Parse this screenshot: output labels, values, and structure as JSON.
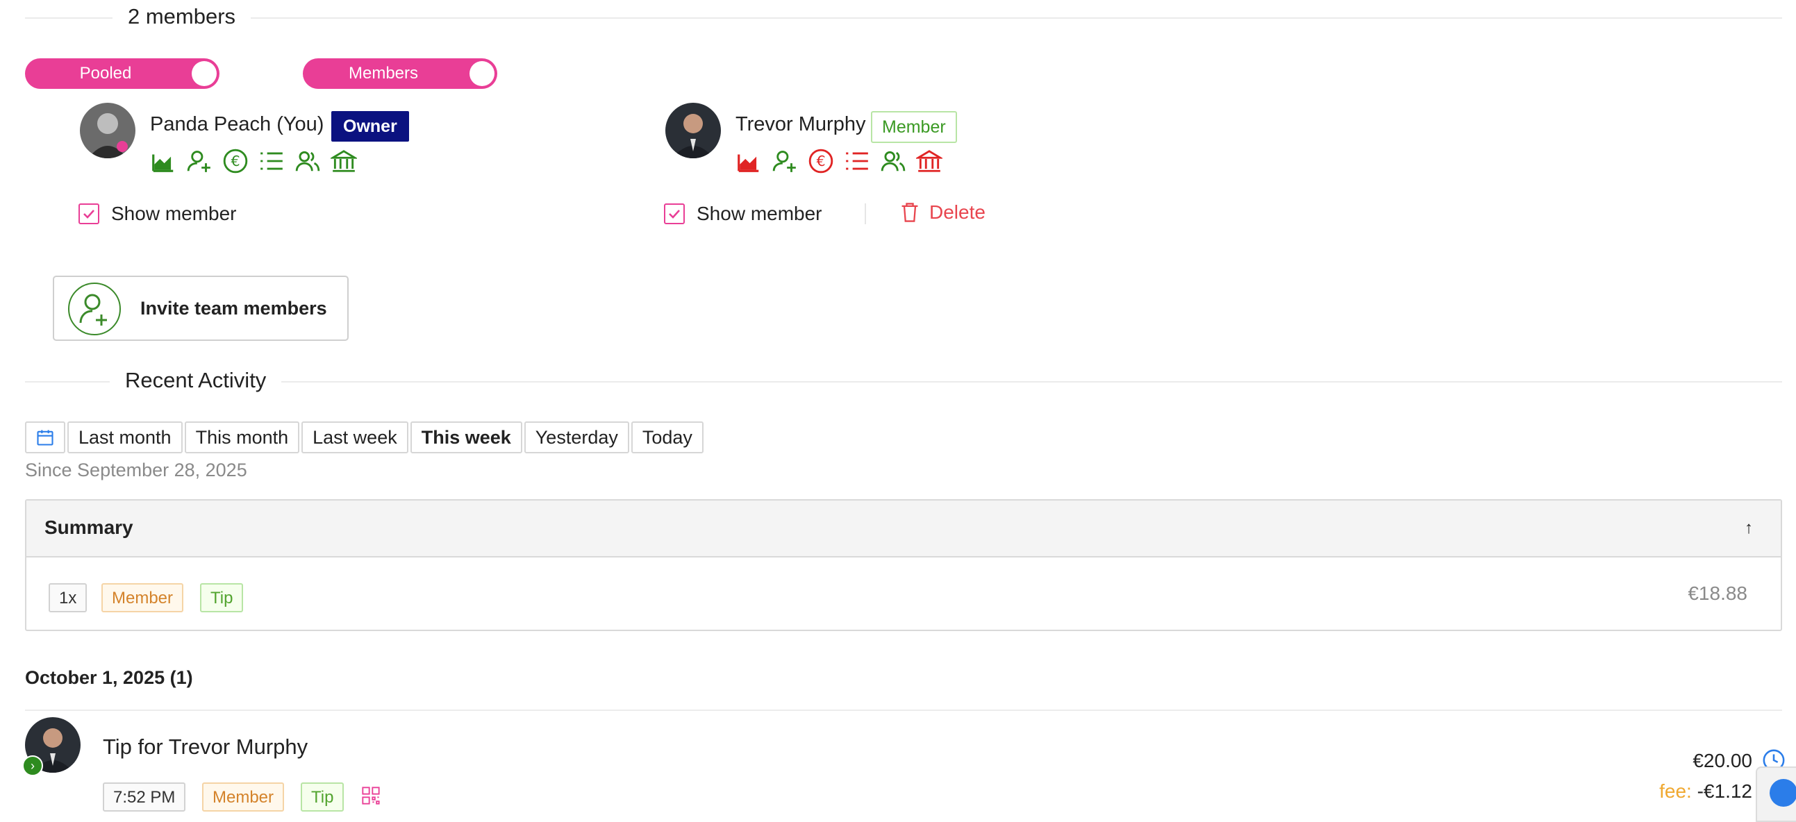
{
  "members_section": {
    "title": "2 members",
    "toggles": [
      {
        "label": "Pooled",
        "on": true
      },
      {
        "label": "Members",
        "on": true
      }
    ],
    "members": [
      {
        "name": "Panda Peach (You)",
        "role": "Owner",
        "icon_color": "#2e8b1f",
        "icons": [
          "chart-area-icon",
          "user-plus-icon",
          "euro-icon",
          "list-icon",
          "users-icon",
          "bank-icon"
        ],
        "show_member_label": "Show member",
        "show_member_checked": true
      },
      {
        "name": "Trevor Murphy",
        "role": "Member",
        "icon_color_mixed": [
          "#e02424",
          "#2e8b1f",
          "#e02424",
          "#e02424",
          "#2e8b1f",
          "#e02424"
        ],
        "icons": [
          "chart-area-icon",
          "user-plus-icon",
          "euro-icon",
          "list-icon",
          "users-icon",
          "bank-icon"
        ],
        "show_member_label": "Show member",
        "show_member_checked": true,
        "delete_label": "Delete"
      }
    ],
    "invite_label": "Invite team members"
  },
  "activity": {
    "title": "Recent Activity",
    "ranges": [
      "Last month",
      "This month",
      "Last week",
      "This week",
      "Yesterday",
      "Today"
    ],
    "active_range": "This week",
    "since": "Since September 28, 2025",
    "summary": {
      "title": "Summary",
      "count": "1x",
      "tags": [
        "Member",
        "Tip"
      ],
      "total": "€18.88"
    },
    "day": {
      "heading": "October 1, 2025 (1)",
      "transactions": [
        {
          "title": "Tip for Trevor Murphy",
          "time": "7:52 PM",
          "tags": [
            "Member",
            "Tip"
          ],
          "amount": "€20.00",
          "fee_label": "fee:",
          "fee": "-€1.12"
        }
      ]
    }
  },
  "colors": {
    "accent_pink": "#e93e96",
    "owner_badge": "#0b1280",
    "success_green": "#2e8b1f",
    "danger_red": "#e8454e"
  }
}
